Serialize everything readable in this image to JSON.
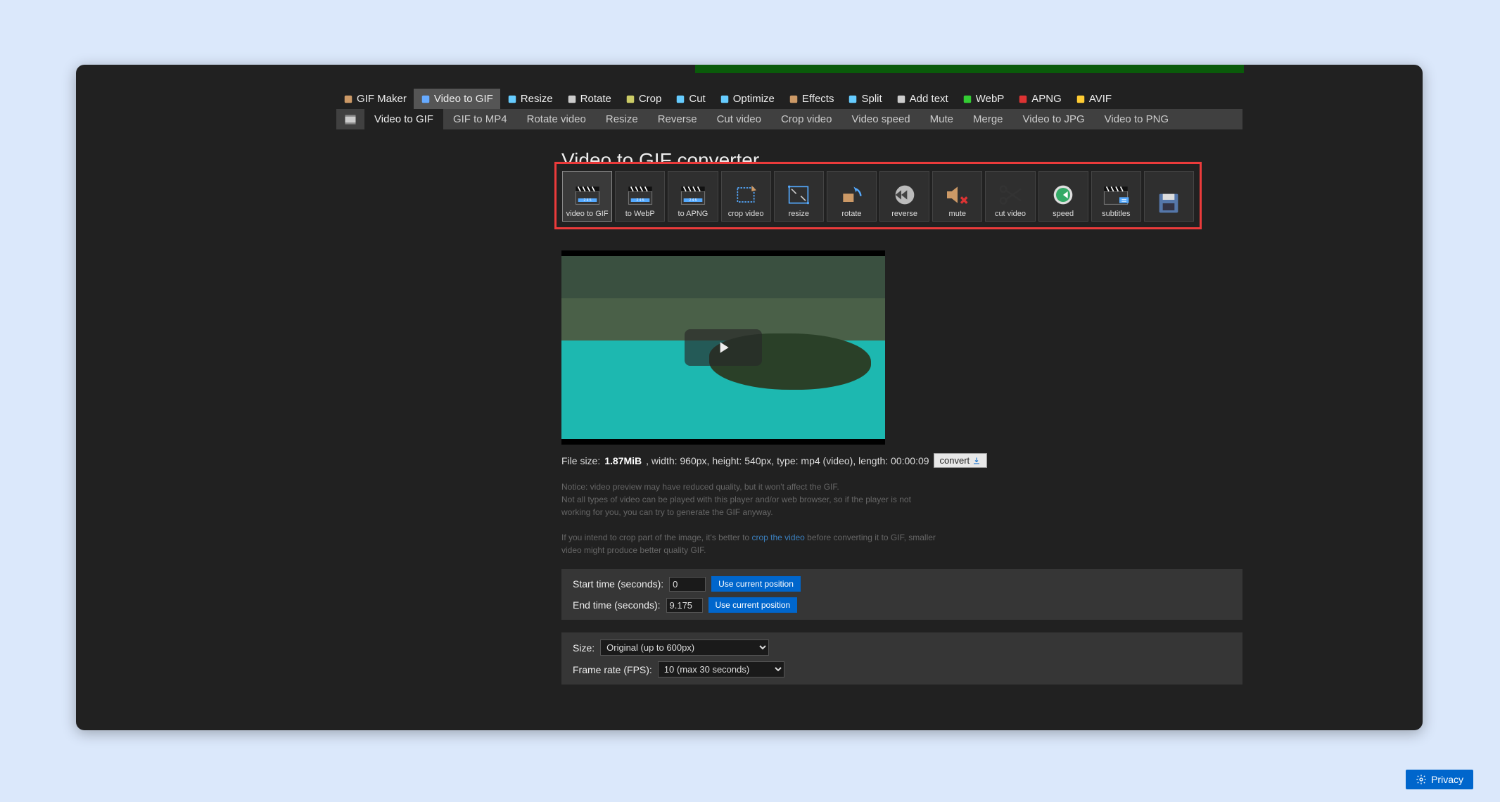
{
  "mainNav": {
    "items": [
      {
        "label": "GIF Maker",
        "icon": "film"
      },
      {
        "label": "Video to GIF",
        "icon": "video",
        "active": true
      },
      {
        "label": "Resize",
        "icon": "resize"
      },
      {
        "label": "Rotate",
        "icon": "rotate"
      },
      {
        "label": "Crop",
        "icon": "crop"
      },
      {
        "label": "Cut",
        "icon": "cut"
      },
      {
        "label": "Optimize",
        "icon": "optimize"
      },
      {
        "label": "Effects",
        "icon": "effects"
      },
      {
        "label": "Split",
        "icon": "split"
      },
      {
        "label": "Add text",
        "icon": "text"
      },
      {
        "label": "WebP",
        "icon": "webp"
      },
      {
        "label": "APNG",
        "icon": "apng"
      },
      {
        "label": "AVIF",
        "icon": "avif"
      }
    ]
  },
  "subNav": {
    "items": [
      {
        "label": "Video to GIF",
        "active": true
      },
      {
        "label": "GIF to MP4"
      },
      {
        "label": "Rotate video"
      },
      {
        "label": "Resize"
      },
      {
        "label": "Reverse"
      },
      {
        "label": "Cut video"
      },
      {
        "label": "Crop video"
      },
      {
        "label": "Video speed"
      },
      {
        "label": "Mute"
      },
      {
        "label": "Merge"
      },
      {
        "label": "Video to JPG"
      },
      {
        "label": "Video to PNG"
      }
    ]
  },
  "page": {
    "title": "Video to GIF converter"
  },
  "tools": [
    {
      "label": "video to GIF",
      "selected": true,
      "icon": "clapper"
    },
    {
      "label": "to WebP",
      "icon": "clapper"
    },
    {
      "label": "to APNG",
      "icon": "clapper"
    },
    {
      "label": "crop video",
      "icon": "crop"
    },
    {
      "label": "resize",
      "icon": "resize"
    },
    {
      "label": "rotate",
      "icon": "rotate"
    },
    {
      "label": "reverse",
      "icon": "reverse"
    },
    {
      "label": "mute",
      "icon": "mute"
    },
    {
      "label": "cut video",
      "icon": "scissors"
    },
    {
      "label": "speed",
      "icon": "speed"
    },
    {
      "label": "subtitles",
      "icon": "subtitles"
    },
    {
      "label": "",
      "icon": "save"
    }
  ],
  "fileInfo": {
    "label_filesize": "File size:",
    "filesize": "1.87MiB",
    "rest": ", width: 960px, height: 540px, type: mp4 (video), length: 00:00:09",
    "convert": "convert"
  },
  "notice": {
    "l1": "Notice: video preview may have reduced quality, but it won't affect the GIF.",
    "l2": "Not all types of video can be played with this player and/or web browser, so if the player is not working for you, you can try to generate the GIF anyway.",
    "l3a": "If you intend to crop part of the image, it's better to ",
    "l3link": "crop the video",
    "l3b": " before converting it to GIF, smaller video might produce better quality GIF."
  },
  "timePanel": {
    "start_label": "Start time (seconds):",
    "start_val": "0",
    "end_label": "End time (seconds):",
    "end_val": "9.175",
    "use_pos": "Use current position"
  },
  "optPanel": {
    "size_label": "Size:",
    "size_val": "Original (up to 600px)",
    "fps_label": "Frame rate (FPS):",
    "fps_val": "10 (max 30 seconds)"
  },
  "privacy": "Privacy"
}
